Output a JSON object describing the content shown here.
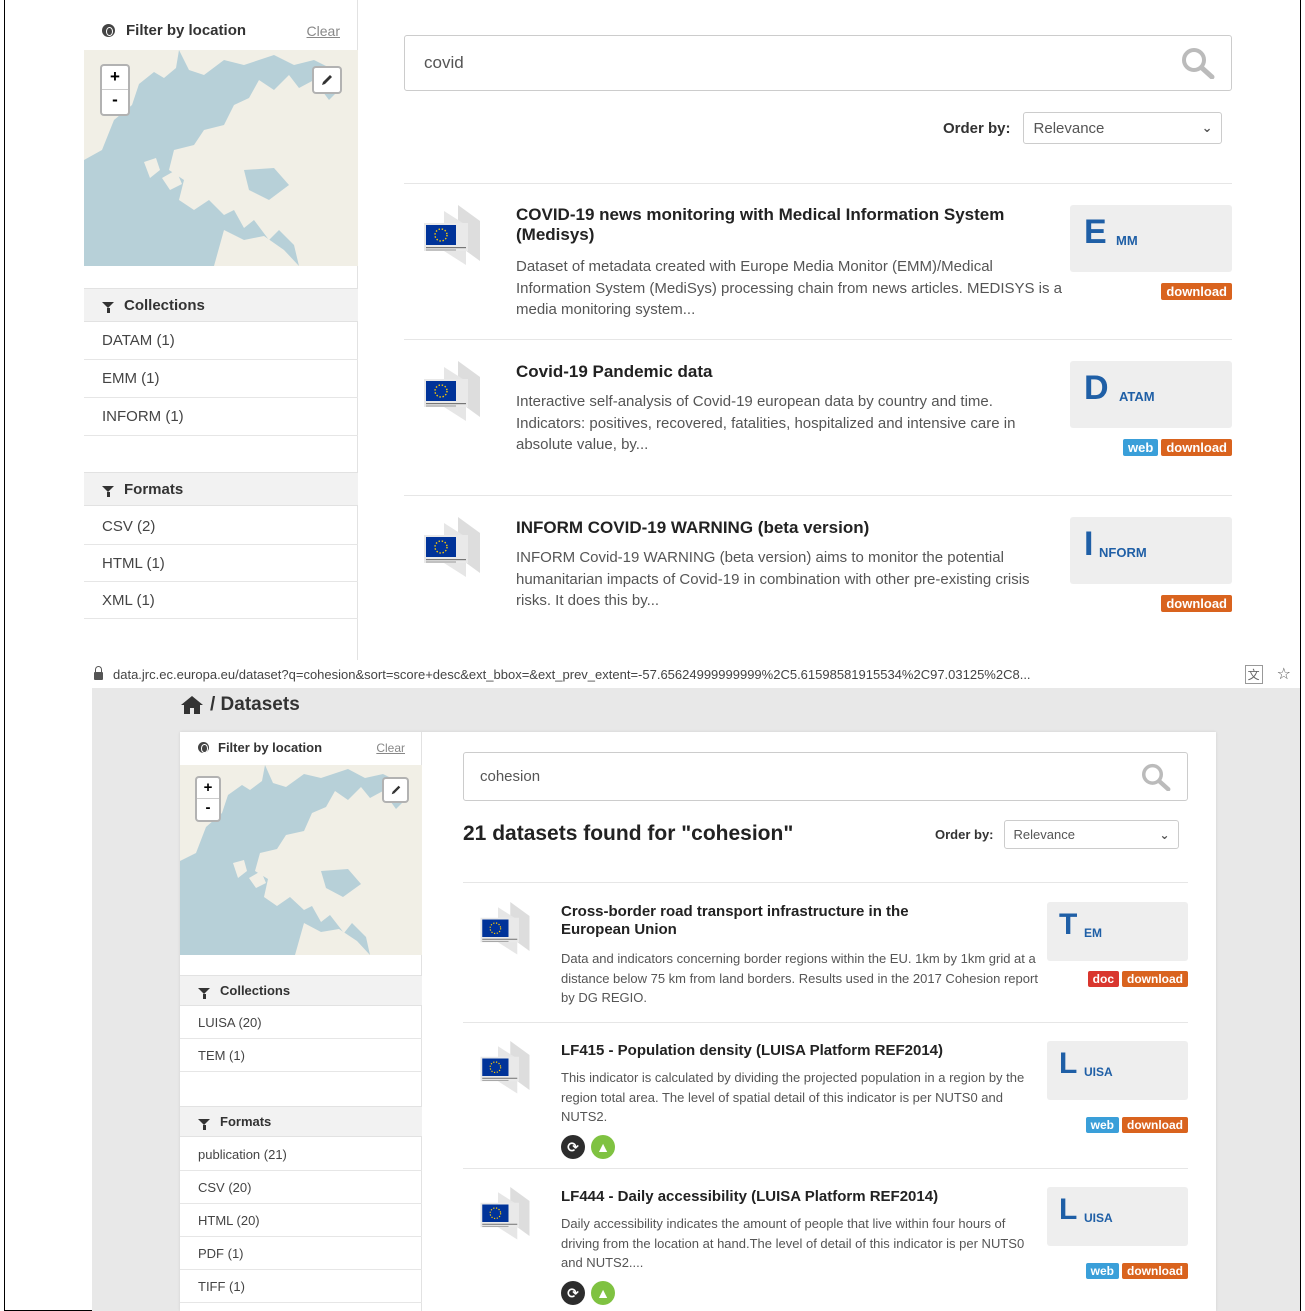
{
  "top": {
    "filter": {
      "title": "Filter by location",
      "clear": "Clear"
    },
    "map": {
      "zoom_in": "+",
      "zoom_out": "-"
    },
    "collections": {
      "title": "Collections",
      "items": [
        "DATAM (1)",
        "EMM (1)",
        "INFORM (1)"
      ]
    },
    "formats": {
      "title": "Formats",
      "items": [
        "CSV (2)",
        "HTML (1)",
        "XML (1)"
      ]
    },
    "search": {
      "value": "covid"
    },
    "order": {
      "label": "Order by:",
      "value": "Relevance"
    },
    "results": [
      {
        "title": "COVID-19 news monitoring with Medical Information System (Medisys)",
        "desc": "Dataset of metadata created with Europe Media Monitor (EMM)/Medical Information System (MediSys) processing chain from news articles. MEDISYS is a media monitoring system...",
        "coll_big": "E",
        "coll_small": "MM",
        "badges": [
          "download"
        ]
      },
      {
        "title": "Covid-19 Pandemic data",
        "desc": "Interactive self-analysis of Covid-19 european data by country and time. Indicators: positives, recovered, fatalities, hospitalized and intensive care in absolute value, by...",
        "coll_big": "D",
        "coll_small": "ATAM",
        "badges": [
          "web",
          "download"
        ]
      },
      {
        "title": "INFORM COVID-19 WARNING (beta version)",
        "desc": "INFORM Covid-19 WARNING (beta version) aims to monitor the potential humanitarian impacts of Covid-19 in combination with other pre-existing crisis risks. It does this by...",
        "coll_big": "I",
        "coll_small": "NFORM",
        "badges": [
          "download"
        ]
      }
    ]
  },
  "urlbar": {
    "url": "data.jrc.ec.europa.eu/dataset?q=cohesion&sort=score+desc&ext_bbox=&ext_prev_extent=-57.65624999999999%2C5.61598581915534%2C97.03125%2C8..."
  },
  "bottom": {
    "breadcrumb": "/ Datasets",
    "filter": {
      "title": "Filter by location",
      "clear": "Clear"
    },
    "map": {
      "zoom_in": "+",
      "zoom_out": "-"
    },
    "collections": {
      "title": "Collections",
      "items": [
        "LUISA (20)",
        "TEM (1)"
      ]
    },
    "formats": {
      "title": "Formats",
      "items": [
        "publication (21)",
        "CSV (20)",
        "HTML (20)",
        "PDF (1)",
        "TIFF (1)"
      ]
    },
    "search": {
      "value": "cohesion"
    },
    "heading": "21 datasets found for \"cohesion\"",
    "order": {
      "label": "Order by:",
      "value": "Relevance"
    },
    "results": [
      {
        "title": "Cross-border road transport infrastructure in the European Union",
        "desc": "Data and indicators concerning border regions within the EU. 1km by 1km grid at a distance below 75 km from land borders. Results used in the 2017 Cohesion report by DG REGIO.",
        "coll_big": "T",
        "coll_small": "EM",
        "badges": [
          "doc",
          "download"
        ]
      },
      {
        "title": "LF415 - Population density (LUISA Platform REF2014)",
        "desc": "This indicator is calculated by dividing the projected population in a region by the region total area. The level of spatial detail of this indicator is per NUTS0 and NUTS2.",
        "coll_big": "L",
        "coll_small": "UISA",
        "badges": [
          "web",
          "download"
        ]
      },
      {
        "title": "LF444 - Daily accessibility (LUISA Platform REF2014)",
        "desc": "Daily accessibility indicates the amount of people that live within four hours of driving from the location at hand.The level of detail of this indicator is per NUTS0 and NUTS2....",
        "coll_big": "L",
        "coll_small": "UISA",
        "badges": [
          "web",
          "download"
        ]
      }
    ]
  },
  "colors": {
    "accent_blue": "#1f5fa6",
    "download": "#d9631e",
    "web": "#3a9fd9",
    "doc": "#d9362e",
    "eu_blue": "#003399",
    "eu_gold": "#ffcc00"
  }
}
